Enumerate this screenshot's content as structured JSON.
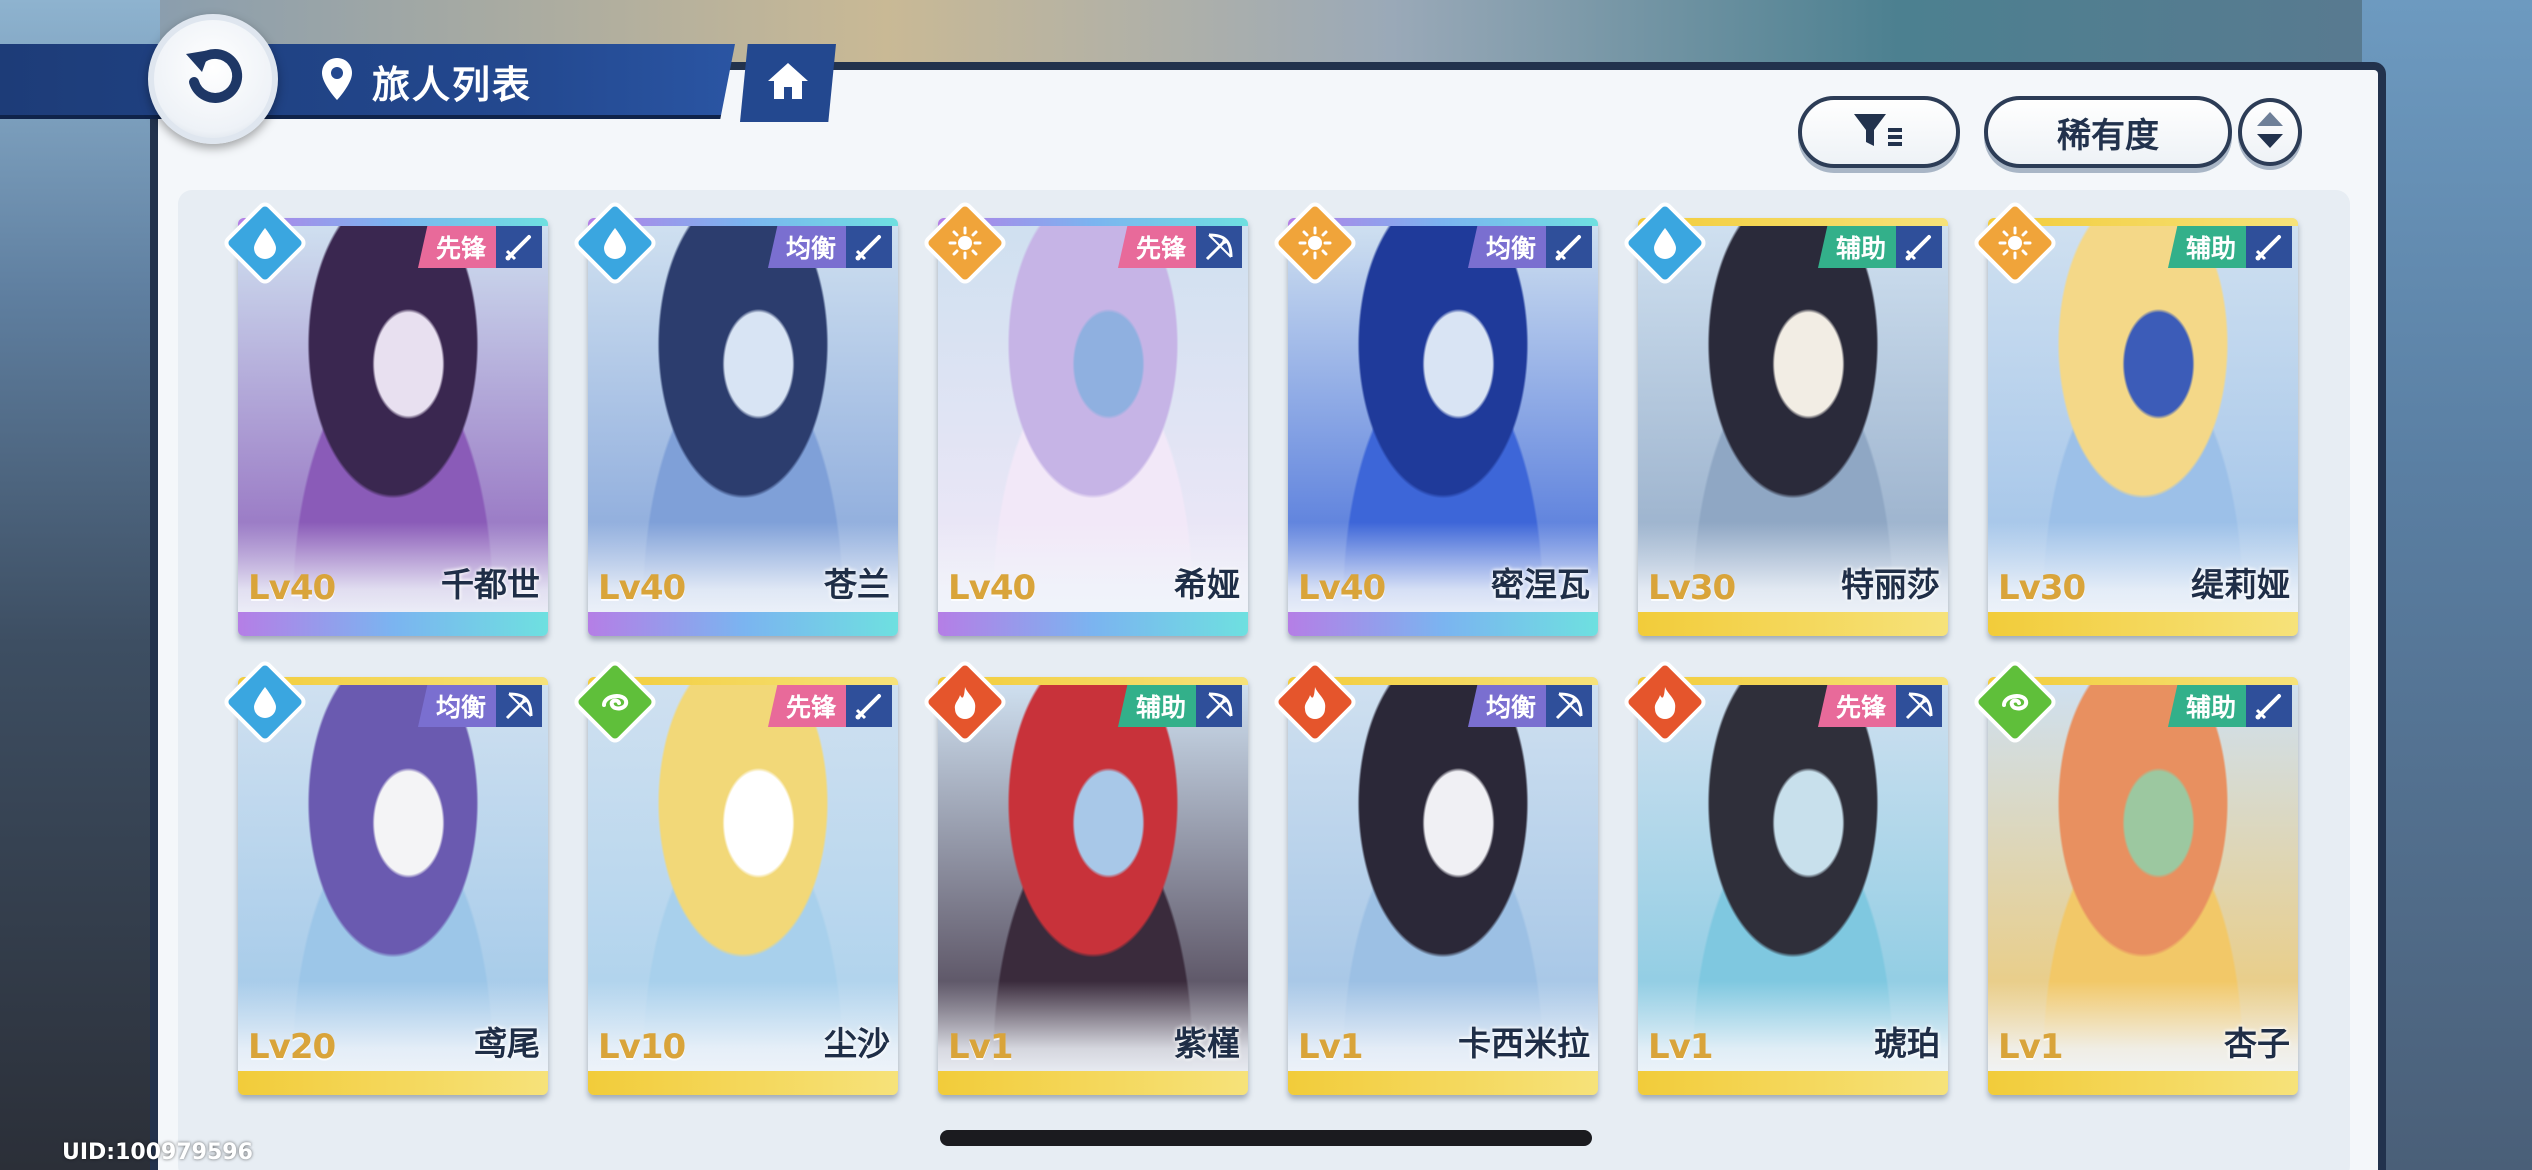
{
  "header": {
    "title": "旅人列表",
    "back_icon": "back-arrow-icon",
    "location_icon": "map-pin-icon",
    "home_icon": "home-icon"
  },
  "toolbar": {
    "filter_icon": "filter-icon",
    "sort_label": "稀有度",
    "order_icon": "sort-order-icon"
  },
  "colors": {
    "panel_border": "#22324d",
    "header_blue": "#23488f",
    "water": "#3aa6e0",
    "sun": "#f0a43a",
    "wind": "#5fbf3a",
    "fire": "#e5552c",
    "role_vanguard": "#e86a9a",
    "role_balance": "#7a6fd0",
    "role_support": "#33b08a",
    "rarity_rainbow": "#b57ee6",
    "rarity_gold": "#f2cc3a",
    "level_text": "#d9a43a"
  },
  "characters": [
    {
      "name": "千都世",
      "level": "Lv40",
      "element": "water",
      "element_icon": "water-drop-icon",
      "role": "先锋",
      "role_type": "vanguard",
      "weapon_icon": "sword-icon",
      "rarity": "rainbow"
    },
    {
      "name": "苍兰",
      "level": "Lv40",
      "element": "water",
      "element_icon": "water-drop-icon",
      "role": "均衡",
      "role_type": "balance",
      "weapon_icon": "sword-icon",
      "rarity": "rainbow"
    },
    {
      "name": "希娅",
      "level": "Lv40",
      "element": "sun",
      "element_icon": "sun-icon",
      "role": "先锋",
      "role_type": "vanguard",
      "weapon_icon": "bow-icon",
      "rarity": "rainbow"
    },
    {
      "name": "密涅瓦",
      "level": "Lv40",
      "element": "sun",
      "element_icon": "sun-icon",
      "role": "均衡",
      "role_type": "balance",
      "weapon_icon": "sword-icon",
      "rarity": "rainbow"
    },
    {
      "name": "特丽莎",
      "level": "Lv30",
      "element": "water",
      "element_icon": "water-drop-icon",
      "role": "辅助",
      "role_type": "support",
      "weapon_icon": "sword-icon",
      "rarity": "gold"
    },
    {
      "name": "缇莉娅",
      "level": "Lv30",
      "element": "sun",
      "element_icon": "sun-icon",
      "role": "辅助",
      "role_type": "support",
      "weapon_icon": "sword-icon",
      "rarity": "gold"
    },
    {
      "name": "鸢尾",
      "level": "Lv20",
      "element": "water",
      "element_icon": "water-drop-icon",
      "role": "均衡",
      "role_type": "balance",
      "weapon_icon": "bow-icon",
      "rarity": "gold"
    },
    {
      "name": "尘沙",
      "level": "Lv10",
      "element": "wind",
      "element_icon": "wind-swirl-icon",
      "role": "先锋",
      "role_type": "vanguard",
      "weapon_icon": "sword-icon",
      "rarity": "gold"
    },
    {
      "name": "紫槿",
      "level": "Lv1",
      "element": "fire",
      "element_icon": "flame-icon",
      "role": "辅助",
      "role_type": "support",
      "weapon_icon": "bow-icon",
      "rarity": "gold"
    },
    {
      "name": "卡西米拉",
      "level": "Lv1",
      "element": "fire",
      "element_icon": "flame-icon",
      "role": "均衡",
      "role_type": "balance",
      "weapon_icon": "bow-icon",
      "rarity": "gold"
    },
    {
      "name": "琥珀",
      "level": "Lv1",
      "element": "fire",
      "element_icon": "flame-icon",
      "role": "先锋",
      "role_type": "vanguard",
      "weapon_icon": "bow-icon",
      "rarity": "gold"
    },
    {
      "name": "杏子",
      "level": "Lv1",
      "element": "wind",
      "element_icon": "wind-swirl-icon",
      "role": "辅助",
      "role_type": "support",
      "weapon_icon": "sword-icon",
      "rarity": "gold"
    }
  ],
  "footer": {
    "uid": "UID:100979596"
  }
}
